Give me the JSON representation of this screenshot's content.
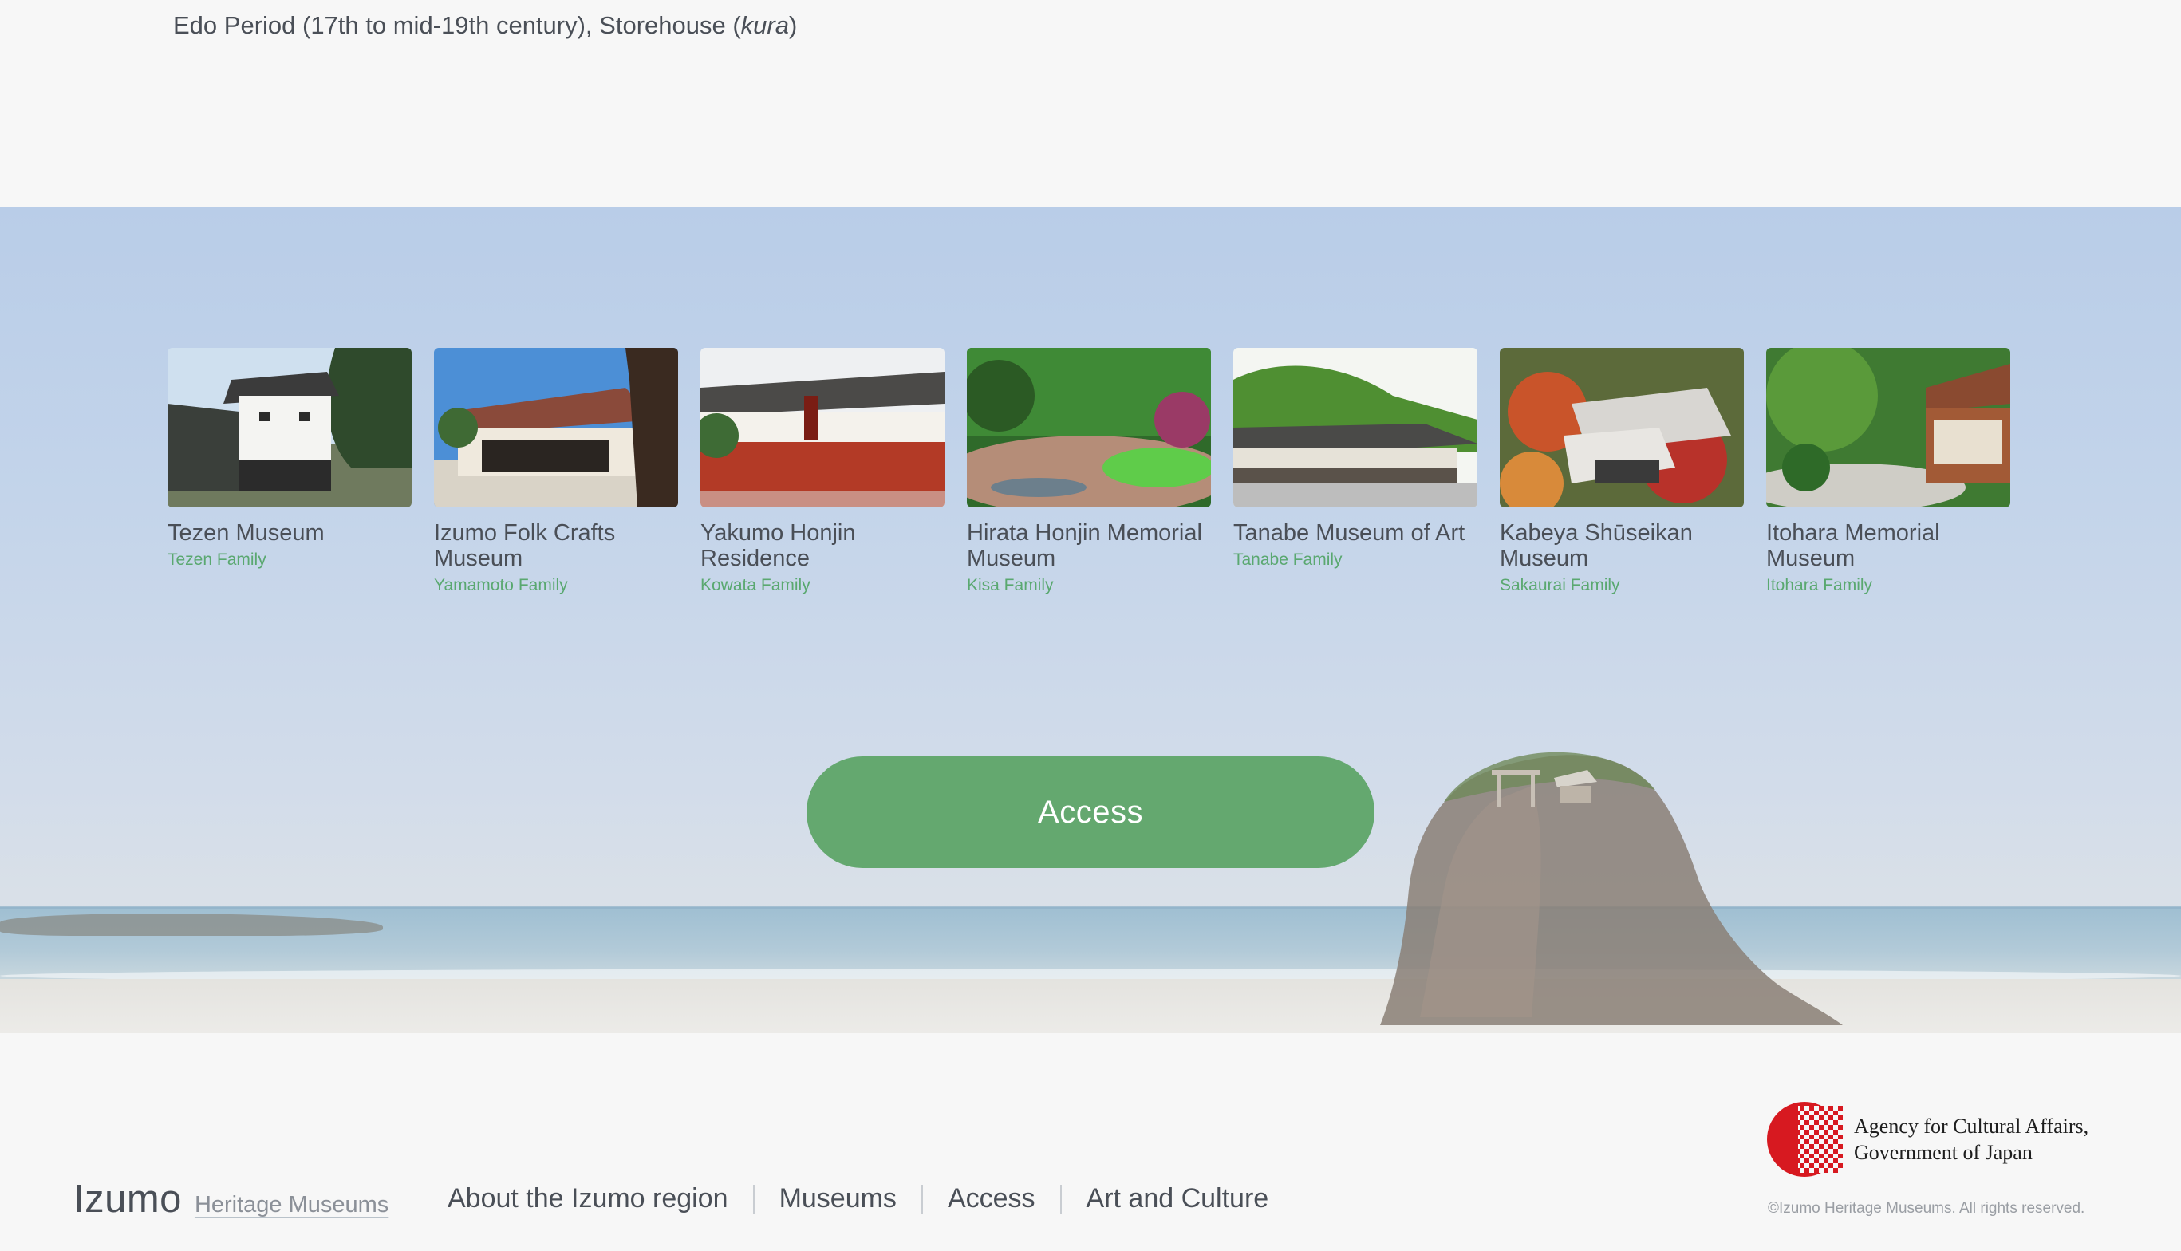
{
  "caption": {
    "prefix": "Edo Period (17th to mid-19th century), Storehouse (",
    "emphasis": "kura",
    "suffix": ")"
  },
  "museums": [
    {
      "title": "Tezen Museum",
      "family": "Tezen Family"
    },
    {
      "title": "Izumo Folk Crafts Museum",
      "family": "Yamamoto Family"
    },
    {
      "title": "Yakumo Honjin Residence",
      "family": "Kowata Family"
    },
    {
      "title": "Hirata Honjin Memorial Museum",
      "family": "Kisa Family"
    },
    {
      "title": "Tanabe Museum of Art",
      "family": "Tanabe Family"
    },
    {
      "title": "Kabeya Shūseikan Museum",
      "family": "Sakaurai Family"
    },
    {
      "title": "Itohara Memorial Museum",
      "family": "Itohara Family"
    }
  ],
  "access_button": "Access",
  "footer": {
    "logo_main": "Izumo",
    "logo_sub": "Heritage Museums",
    "nav": [
      "About the Izumo region",
      "Museums",
      "Access",
      "Art and Culture"
    ],
    "agency_line1": "Agency for Cultural Affairs,",
    "agency_line2": "Government of Japan",
    "copyright": "©Izumo Heritage Museums. All rights reserved."
  },
  "colors": {
    "accent_green": "#64a86f",
    "family_green": "#5aa870",
    "text": "#4a4f57",
    "agency_red": "#d71920"
  }
}
